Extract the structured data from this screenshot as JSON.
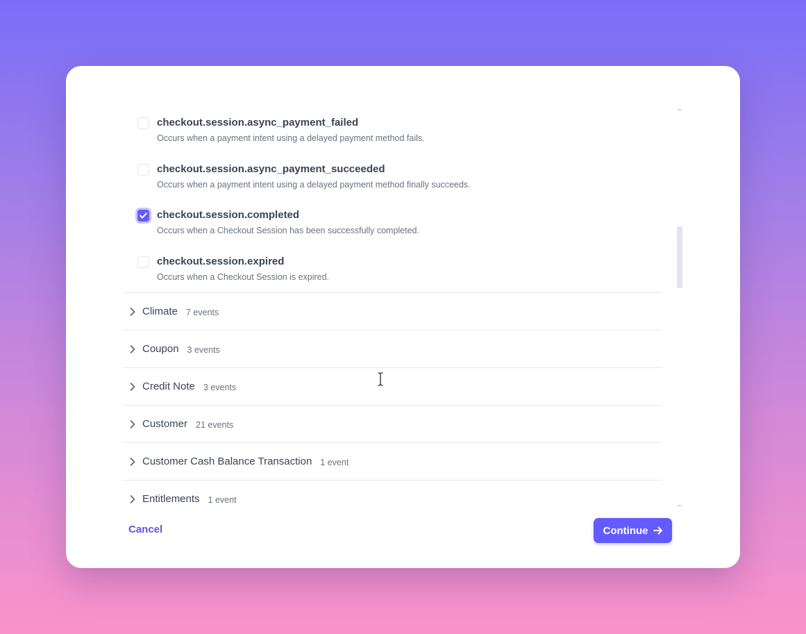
{
  "events": [
    {
      "name": "checkout.session.async_payment_failed",
      "description": "Occurs when a payment intent using a delayed payment method fails.",
      "checked": false
    },
    {
      "name": "checkout.session.async_payment_succeeded",
      "description": "Occurs when a payment intent using a delayed payment method finally succeeds.",
      "checked": false
    },
    {
      "name": "checkout.session.completed",
      "description": "Occurs when a Checkout Session has been successfully completed.",
      "checked": true
    },
    {
      "name": "checkout.session.expired",
      "description": "Occurs when a Checkout Session is expired.",
      "checked": false
    }
  ],
  "groups": [
    {
      "name": "Climate",
      "count": "7 events"
    },
    {
      "name": "Coupon",
      "count": "3 events"
    },
    {
      "name": "Credit Note",
      "count": "3 events"
    },
    {
      "name": "Customer",
      "count": "21 events"
    },
    {
      "name": "Customer Cash Balance Transaction",
      "count": "1 event"
    },
    {
      "name": "Entitlements",
      "count": "1 event"
    }
  ],
  "footer": {
    "cancel_label": "Cancel",
    "continue_label": "Continue"
  },
  "icons": {
    "chevron": "chevron-right-icon",
    "check": "check-icon",
    "arrow": "arrow-right-icon"
  },
  "colors": {
    "accent": "#635bff",
    "cancel_text": "#5e57d6"
  }
}
